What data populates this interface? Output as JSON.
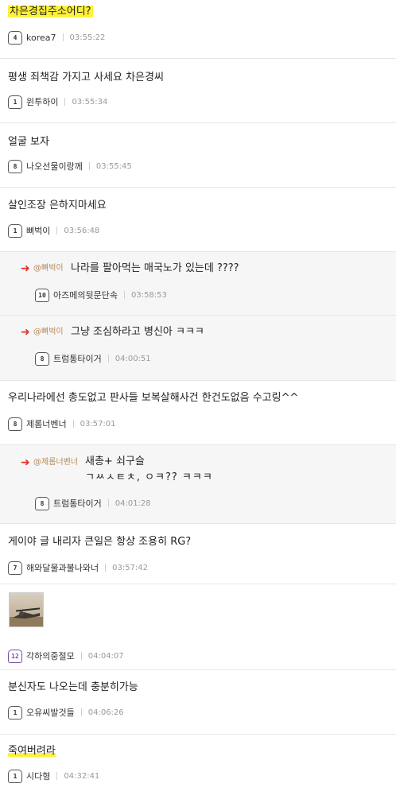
{
  "comments": [
    {
      "text": "차은경집주소어디?",
      "level": "4",
      "nick": "korea7",
      "time": "03:55:22"
    },
    {
      "text": "평생 죄책감 가지고 사세요 차은경씨",
      "level": "1",
      "nick": "윈투하이",
      "time": "03:55:34"
    },
    {
      "text": "얼굴 보자",
      "level": "8",
      "nick": "나오선물이랑께",
      "time": "03:55:45"
    },
    {
      "text": "살인조장 은하지마세요",
      "level": "1",
      "nick": "뼈벅이",
      "time": "03:56:48"
    },
    {
      "mention": "@뼈벅이",
      "text": "나라를 팔아먹는 매국노가 있는데 ????",
      "level": "10",
      "nick": "아즈메의뒷문단속",
      "time": "03:58:53"
    },
    {
      "mention": "@뼈벅이",
      "text": "그냥 조심하라고 병신아 ㅋㅋㅋ",
      "level": "8",
      "nick": "트럼통타이거",
      "time": "04:00:51"
    },
    {
      "text": "우리나라에선 총도없고 판사들 보복살해사건 한건도없음 수고링^^",
      "level": "8",
      "nick": "제롬너벤너",
      "time": "03:57:01"
    },
    {
      "mention": "@제롬너벤너",
      "text": "새총+ 쇠구슬",
      "text2": "ㄱㅆㅅㅌㅊ, ㅇㅋ?? ㅋㅋㅋ",
      "level": "8",
      "nick": "트럼통타이거",
      "time": "04:01:28"
    },
    {
      "text": "게이야 글 내리자 큰일은 항상 조용히 RG?",
      "level": "7",
      "nick": "해와달물과불나와너",
      "time": "03:57:42"
    },
    {
      "image": "sniper-rifle-image",
      "level": "12",
      "nick": "각하의중절모",
      "time": "04:04:07"
    },
    {
      "text": "분신자도 나오는데 충분히가능",
      "level": "1",
      "nick": "오유씨발것들",
      "time": "04:06:26"
    },
    {
      "text": "죽여버려라",
      "level": "1",
      "nick": "시다형",
      "time": "04:32:41"
    }
  ],
  "colors": {
    "highlight": "#fff13a",
    "reply_arrow": "#e8312a",
    "mention": "#b88a5a",
    "reply_bg": "#f6f6f6"
  }
}
